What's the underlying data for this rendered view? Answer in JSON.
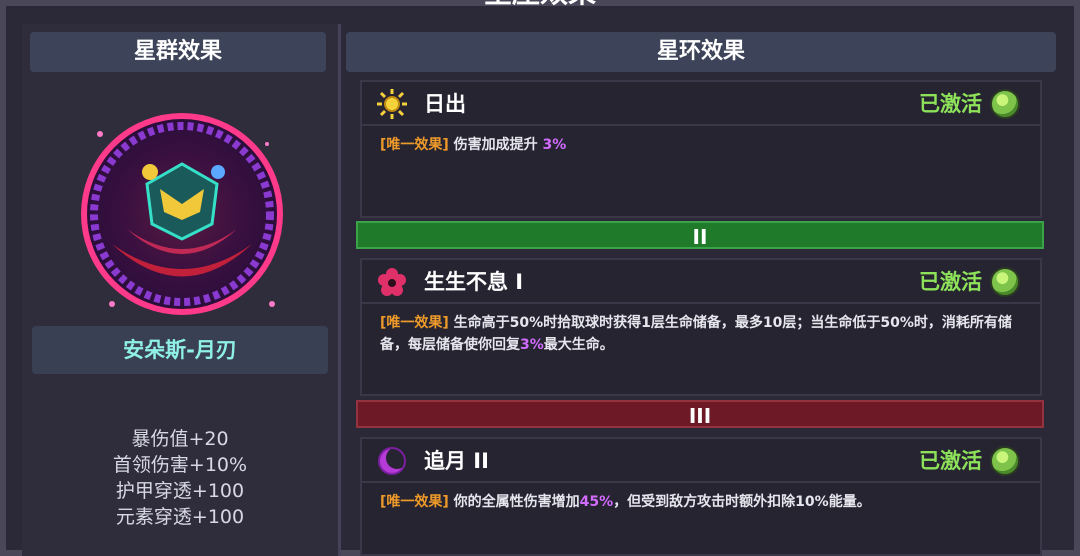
{
  "window": {
    "title": "星座效果"
  },
  "left_panel": {
    "header": "星群效果",
    "emblem_icon": "constellation-emblem-icon",
    "character_name": "安朵斯-月刃",
    "stats": [
      "暴伤值+20",
      "首领伤害+10%",
      "护甲穿透+100",
      "元素穿透+100"
    ]
  },
  "right_panel": {
    "header": "星环效果",
    "tiers": [
      {
        "label": "II",
        "color": "#1f7a2a"
      },
      {
        "label": "III",
        "color": "#6e1a26"
      }
    ],
    "effects": [
      {
        "icon": "sun-icon",
        "name": "日出",
        "status": "已激活",
        "tag": "[唯一效果]",
        "desc_before": "伤害加成提升",
        "highlight": "3%",
        "desc_after": ""
      },
      {
        "icon": "flower-icon",
        "name": "生生不息 I",
        "status": "已激活",
        "tag": "[唯一效果]",
        "desc_before": "生命高于50%时拾取球时获得1层生命储备，最多10层；当生命低于50%时，消耗所有储备，每层储备使你回复",
        "highlight": "3%",
        "desc_after": "最大生命。"
      },
      {
        "icon": "crescent-moon-icon",
        "name": "追月 II",
        "status": "已激活",
        "tag": "[唯一效果]",
        "desc_before": "你的全属性伤害增加",
        "highlight": "45%",
        "desc_after": "，但受到敌方攻击时额外扣除10%能量。"
      }
    ]
  }
}
